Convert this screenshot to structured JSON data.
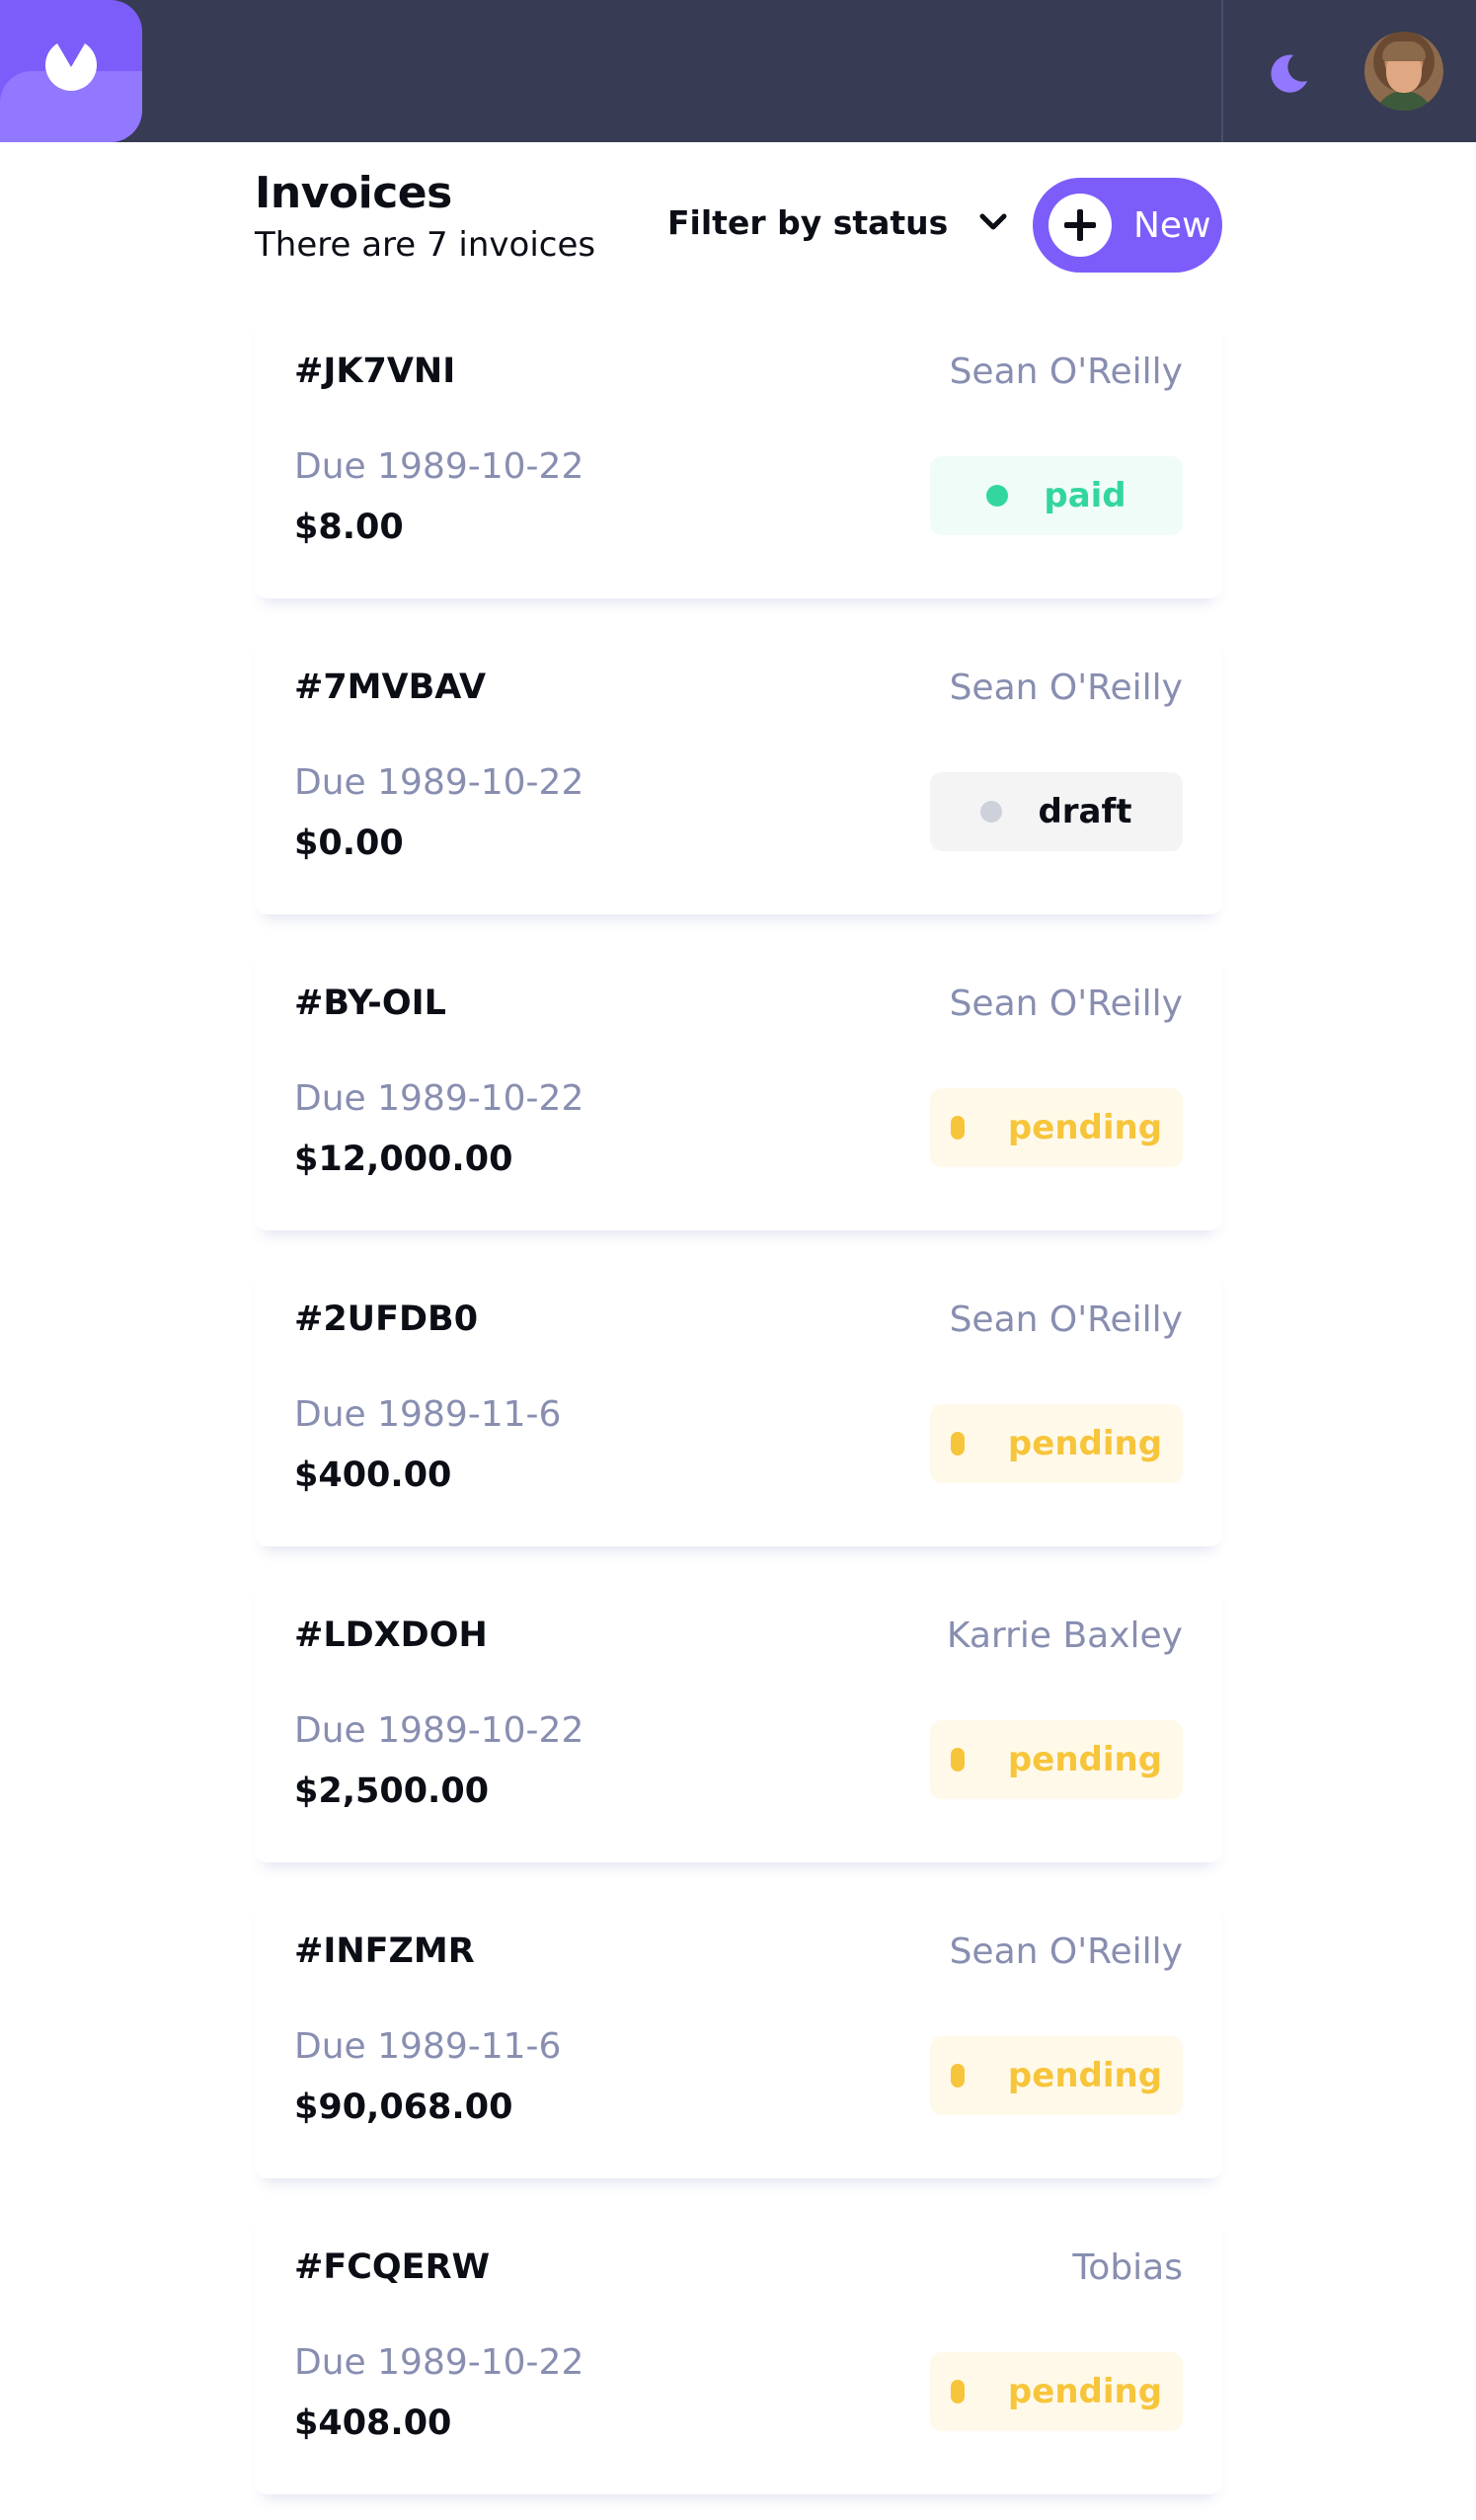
{
  "header": {
    "title": "Invoices",
    "subtitle": "There are 7 invoices",
    "filter_label": "Filter by status",
    "new_button_label": "New"
  },
  "topbar": {
    "logo_icon": "logo-icon",
    "theme_icon": "moon-icon",
    "avatar": "user-avatar"
  },
  "colors": {
    "accent": "#7c5dfa",
    "topbar": "#373b53",
    "paid": "#33d69f",
    "pending": "#f7c53b",
    "draft": "#ced1d9"
  },
  "invoices": [
    {
      "id": "#JK7VNI",
      "client": "Sean O'Reilly",
      "due": "Due 1989-10-22",
      "amount": "$8.00",
      "status": "paid"
    },
    {
      "id": "#7MVBAV",
      "client": "Sean O'Reilly",
      "due": "Due 1989-10-22",
      "amount": "$0.00",
      "status": "draft"
    },
    {
      "id": "#BY-OIL",
      "client": "Sean O'Reilly",
      "due": "Due 1989-10-22",
      "amount": "$12,000.00",
      "status": "pending"
    },
    {
      "id": "#2UFDB0",
      "client": "Sean O'Reilly",
      "due": "Due 1989-11-6",
      "amount": "$400.00",
      "status": "pending"
    },
    {
      "id": "#LDXDOH",
      "client": "Karrie Baxley",
      "due": "Due 1989-10-22",
      "amount": "$2,500.00",
      "status": "pending"
    },
    {
      "id": "#INFZMR",
      "client": "Sean O'Reilly",
      "due": "Due 1989-11-6",
      "amount": "$90,068.00",
      "status": "pending"
    },
    {
      "id": "#FCQERW",
      "client": "Tobias",
      "due": "Due 1989-10-22",
      "amount": "$408.00",
      "status": "pending"
    }
  ]
}
